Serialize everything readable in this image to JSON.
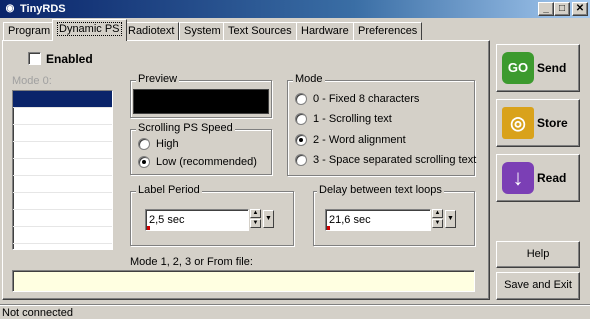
{
  "window": {
    "title": "TinyRDS",
    "controls": {
      "minimize": "_",
      "maximize": "□",
      "close": "✕"
    }
  },
  "tabs": [
    {
      "label": "Program",
      "active": false
    },
    {
      "label": "Dynamic PS",
      "active": true
    },
    {
      "label": "Radiotext",
      "active": false
    },
    {
      "label": "System",
      "active": false
    },
    {
      "label": "Text Sources",
      "active": false
    },
    {
      "label": "Hardware",
      "active": false
    },
    {
      "label": "Preferences",
      "active": false
    }
  ],
  "enabled": {
    "label": "Enabled",
    "checked": false
  },
  "mode0": {
    "label": "Mode 0:",
    "rows": 10,
    "selected_row": 0
  },
  "preview": {
    "label": "Preview"
  },
  "scroll_speed": {
    "label": "Scrolling PS Speed",
    "options": [
      {
        "label": "High",
        "selected": false
      },
      {
        "label": "Low (recommended)",
        "selected": true
      }
    ]
  },
  "mode": {
    "label": "Mode",
    "options": [
      {
        "label": "0 - Fixed 8 characters",
        "selected": false
      },
      {
        "label": "1 - Scrolling text",
        "selected": false
      },
      {
        "label": "2 - Word alignment",
        "selected": true
      },
      {
        "label": "3 - Space separated scrolling text",
        "selected": false
      }
    ]
  },
  "label_period": {
    "label": "Label Period",
    "value": "2,5 sec"
  },
  "delay_loops": {
    "label": "Delay between text loops",
    "value": "21,6 sec"
  },
  "file_input": {
    "label": "Mode 1, 2, 3 or From file:",
    "value": ""
  },
  "actions": {
    "send": {
      "label": "Send",
      "icon": "go-icon",
      "color": "#3c9a2e"
    },
    "store": {
      "label": "Store",
      "icon": "safe-icon",
      "color": "#d9a21b"
    },
    "read": {
      "label": "Read",
      "icon": "down-arrow-icon",
      "color": "#7b3fb5"
    },
    "help": {
      "label": "Help"
    },
    "save_exit": {
      "label": "Save and Exit"
    }
  },
  "statusbar": {
    "text": "Not connected"
  },
  "colors": {
    "selection": "#0a246a",
    "input_bg": "#ffffe1"
  }
}
